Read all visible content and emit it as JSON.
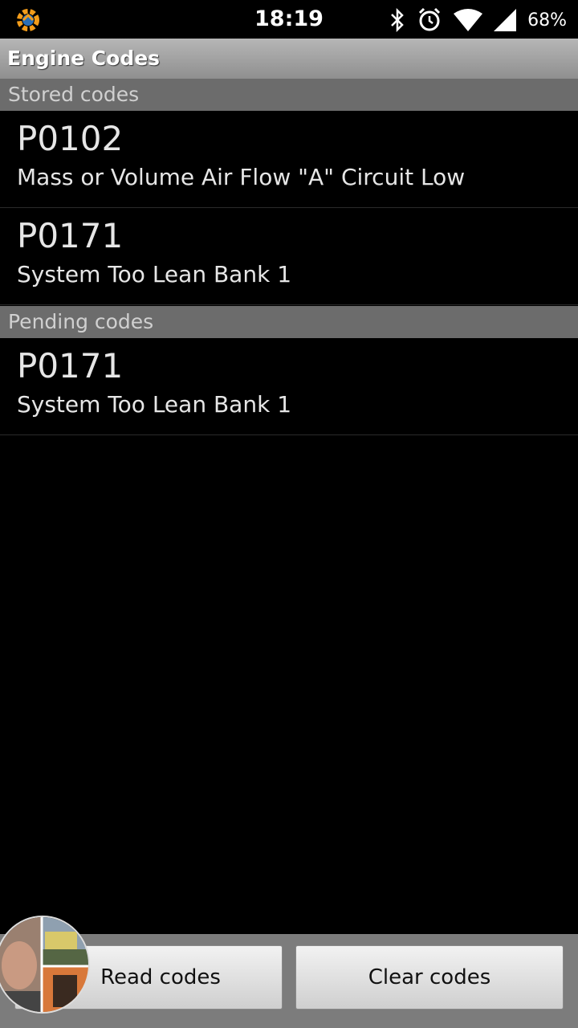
{
  "status_bar": {
    "time": "18:19",
    "battery": "68%",
    "icons": [
      "app-icon",
      "bluetooth-icon",
      "alarm-icon",
      "wifi-icon",
      "signal-icon"
    ]
  },
  "titlebar": {
    "title": "Engine Codes"
  },
  "sections": {
    "stored": {
      "header": "Stored codes",
      "items": [
        {
          "code": "P0102",
          "desc": "Mass or Volume Air Flow \"A\" Circuit Low"
        },
        {
          "code": "P0171",
          "desc": "System Too Lean Bank 1"
        }
      ]
    },
    "pending": {
      "header": "Pending codes",
      "items": [
        {
          "code": "P0171",
          "desc": "System Too Lean Bank 1"
        }
      ]
    }
  },
  "buttons": {
    "read": "Read codes",
    "clear": "Clear codes"
  },
  "colors": {
    "section_header_bg": "#6c6c6c",
    "titlebar_bg": "#a3a3a3",
    "bottom_bar_bg": "#7c7c7c"
  }
}
